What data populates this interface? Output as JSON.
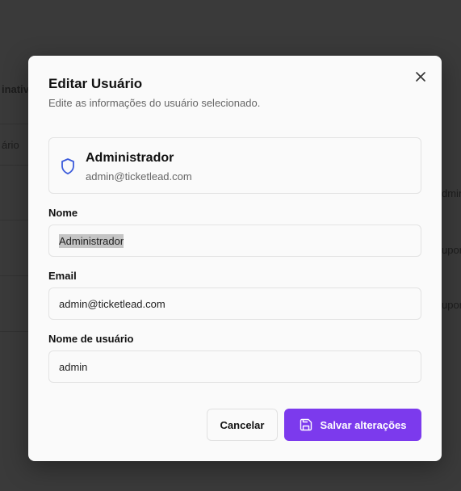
{
  "background": {
    "fragments": [
      "inativ",
      "ário",
      "dmin",
      "upor",
      "upor"
    ]
  },
  "modal": {
    "title": "Editar Usuário",
    "subtitle": "Edite as informações do usuário selecionado.",
    "close_icon": "close-icon",
    "user_card": {
      "icon": "shield-icon",
      "name": "Administrador",
      "email": "admin@ticketlead.com"
    },
    "fields": {
      "name": {
        "label": "Nome",
        "value": "Administrador"
      },
      "email": {
        "label": "Email",
        "value": "admin@ticketlead.com"
      },
      "username": {
        "label": "Nome de usuário",
        "value": "admin"
      }
    },
    "buttons": {
      "cancel": "Cancelar",
      "save": "Salvar alterações",
      "save_icon": "save-icon"
    },
    "colors": {
      "accent": "#7c3aed",
      "shield": "#3b5bdb"
    }
  }
}
